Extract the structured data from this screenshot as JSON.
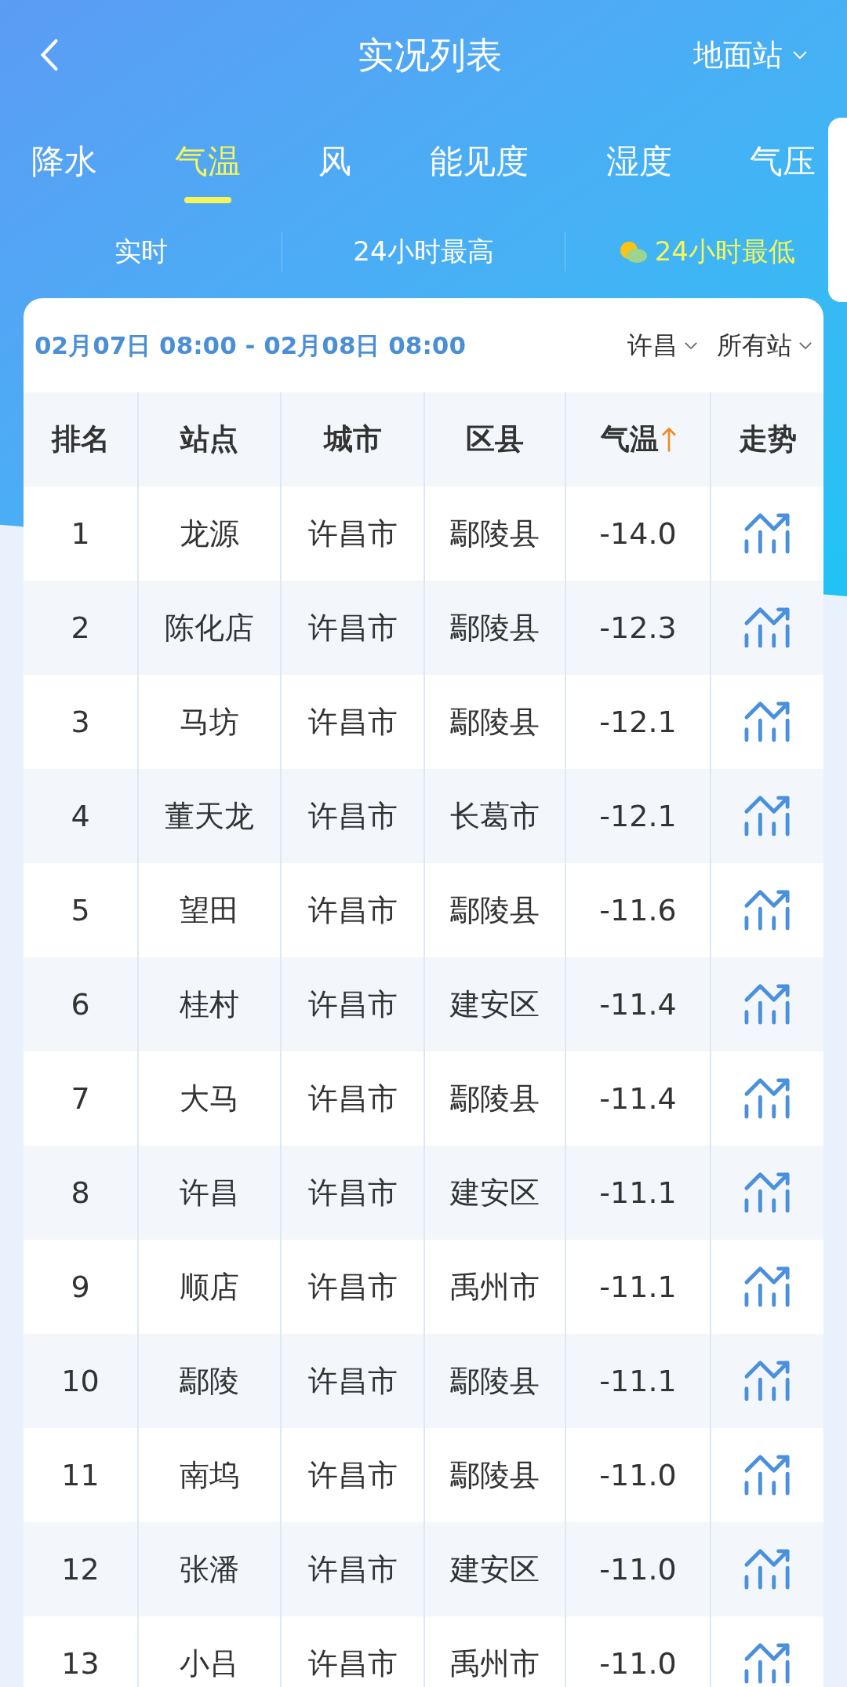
{
  "header": {
    "title": "实况列表",
    "station_type": "地面站"
  },
  "tabs": [
    {
      "label": "降水",
      "selected": false
    },
    {
      "label": "气温",
      "selected": true
    },
    {
      "label": "风",
      "selected": false
    },
    {
      "label": "能见度",
      "selected": false
    },
    {
      "label": "湿度",
      "selected": false
    },
    {
      "label": "气压",
      "selected": false
    }
  ],
  "subtabs": [
    {
      "label": "实时",
      "selected": false
    },
    {
      "label": "24小时最高",
      "selected": false
    },
    {
      "label": "24小时最低",
      "selected": true
    }
  ],
  "filter": {
    "time_range": "02月07日 08:00 - 02月08日 08:00",
    "city": "许昌",
    "stations": "所有站"
  },
  "table": {
    "columns": [
      {
        "label": "排名",
        "sorted": false
      },
      {
        "label": "站点",
        "sorted": false
      },
      {
        "label": "城市",
        "sorted": false
      },
      {
        "label": "区县",
        "sorted": false
      },
      {
        "label": "气温",
        "sorted": true
      },
      {
        "label": "走势",
        "sorted": false
      }
    ],
    "rows": [
      {
        "rank": "1",
        "station": "龙源",
        "city": "许昌市",
        "county": "鄢陵县",
        "temp": "-14.0"
      },
      {
        "rank": "2",
        "station": "陈化店",
        "city": "许昌市",
        "county": "鄢陵县",
        "temp": "-12.3"
      },
      {
        "rank": "3",
        "station": "马坊",
        "city": "许昌市",
        "county": "鄢陵县",
        "temp": "-12.1"
      },
      {
        "rank": "4",
        "station": "董天龙",
        "city": "许昌市",
        "county": "长葛市",
        "temp": "-12.1"
      },
      {
        "rank": "5",
        "station": "望田",
        "city": "许昌市",
        "county": "鄢陵县",
        "temp": "-11.6"
      },
      {
        "rank": "6",
        "station": "桂村",
        "city": "许昌市",
        "county": "建安区",
        "temp": "-11.4"
      },
      {
        "rank": "7",
        "station": "大马",
        "city": "许昌市",
        "county": "鄢陵县",
        "temp": "-11.4"
      },
      {
        "rank": "8",
        "station": "许昌",
        "city": "许昌市",
        "county": "建安区",
        "temp": "-11.1"
      },
      {
        "rank": "9",
        "station": "顺店",
        "city": "许昌市",
        "county": "禹州市",
        "temp": "-11.1"
      },
      {
        "rank": "10",
        "station": "鄢陵",
        "city": "许昌市",
        "county": "鄢陵县",
        "temp": "-11.1"
      },
      {
        "rank": "11",
        "station": "南坞",
        "city": "许昌市",
        "county": "鄢陵县",
        "temp": "-11.0"
      },
      {
        "rank": "12",
        "station": "张潘",
        "city": "许昌市",
        "county": "建安区",
        "temp": "-11.0"
      },
      {
        "rank": "13",
        "station": "小吕",
        "city": "许昌市",
        "county": "禹州市",
        "temp": "-11.0"
      }
    ]
  }
}
